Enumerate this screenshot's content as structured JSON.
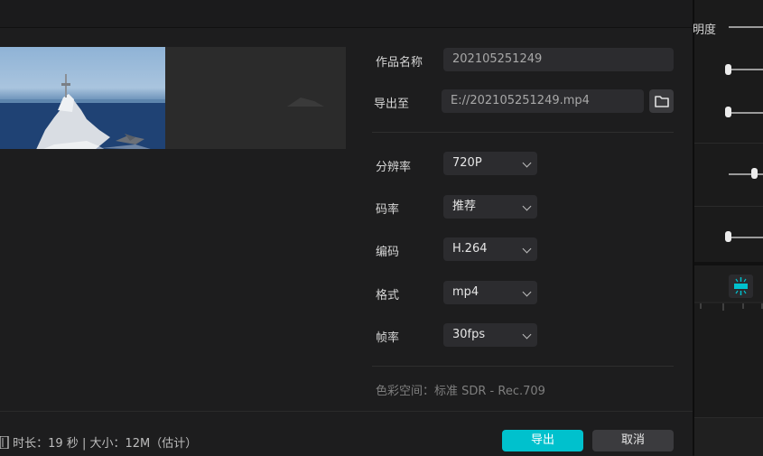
{
  "dialog": {
    "title_label": "作品名称",
    "title_value": "202105251249",
    "export_to_label": "导出至",
    "export_path": "E://202105251249.mp4",
    "resolution": {
      "label": "分辨率",
      "value": "720P"
    },
    "bitrate": {
      "label": "码率",
      "value": "推荐"
    },
    "codec": {
      "label": "编码",
      "value": "H.264"
    },
    "format": {
      "label": "格式",
      "value": "mp4"
    },
    "framerate": {
      "label": "帧率",
      "value": "30fps"
    },
    "color_space": "色彩空间：标准 SDR - Rec.709",
    "info": "时长：19 秒 | 大小：12M（估计）",
    "export_button": "导出",
    "cancel_button": "取消"
  },
  "right_panel": {
    "label_partial": "明度"
  },
  "colors": {
    "accent": "#00c1cd"
  }
}
